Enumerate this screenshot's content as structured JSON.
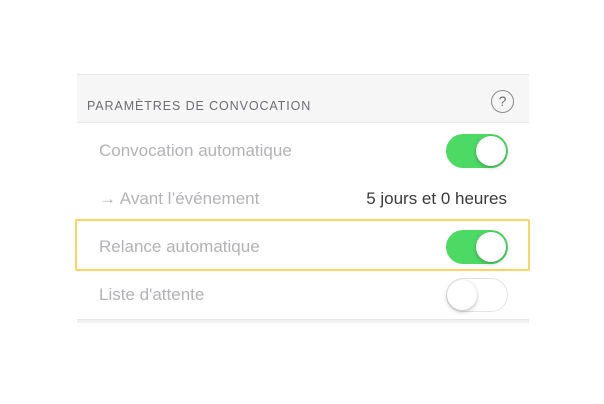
{
  "section": {
    "title": "PARAMÈTRES DE CONVOCATION",
    "help_icon": "question-circle-icon",
    "help_glyph": "?"
  },
  "rows": [
    {
      "label": "Convocation automatique",
      "toggle": "on"
    },
    {
      "label": "→ Avant l’événement",
      "value": "5 jours et 0 heures"
    },
    {
      "label": "Relance automatique",
      "toggle": "on",
      "highlighted": true
    },
    {
      "label": "Liste d'attente",
      "toggle": "off"
    }
  ],
  "colors": {
    "toggle_on": "#4cd964",
    "highlight": "#ffd266",
    "label_disabled": "#b3b3b7"
  }
}
